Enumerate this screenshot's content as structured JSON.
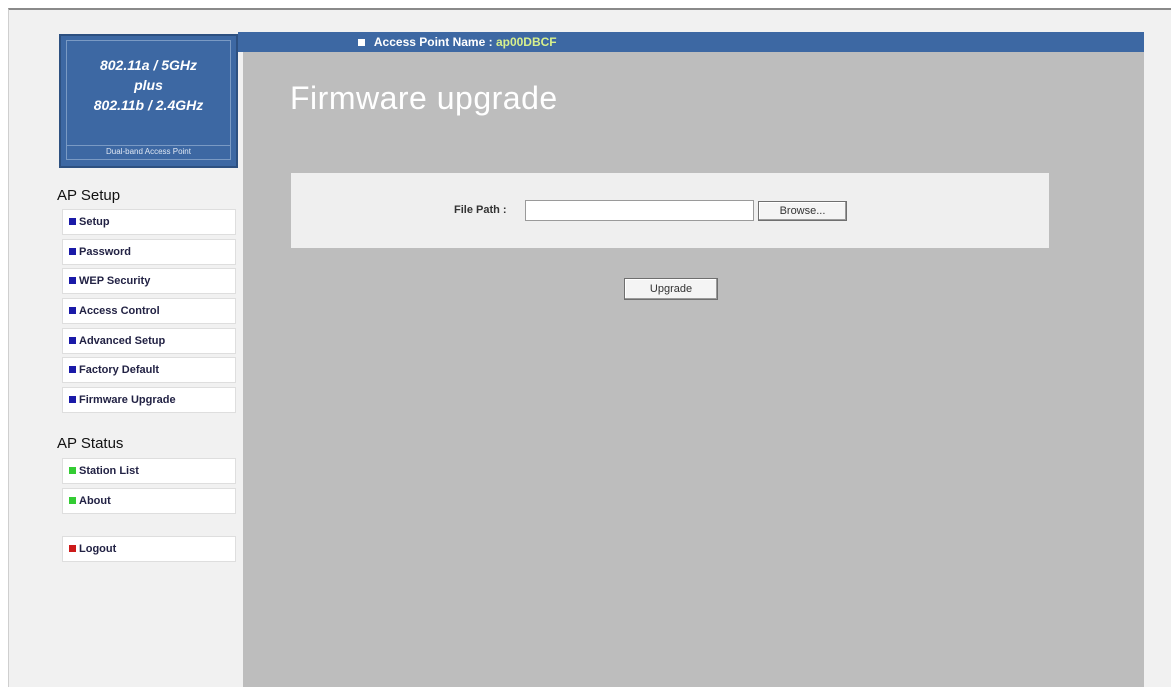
{
  "header": {
    "ap_label": "Access Point Name :",
    "ap_name": "ap00DBCF"
  },
  "logo": {
    "line1": "802.11a / 5GHz",
    "line2": "plus",
    "line3": "802.11b / 2.4GHz",
    "subtitle": "Dual-band Access Point"
  },
  "sidebar": {
    "setup_title": "AP Setup",
    "setup_items": [
      {
        "label": "Setup"
      },
      {
        "label": "Password"
      },
      {
        "label": "WEP Security"
      },
      {
        "label": "Access Control"
      },
      {
        "label": "Advanced Setup"
      },
      {
        "label": "Factory Default"
      },
      {
        "label": "Firmware Upgrade"
      }
    ],
    "status_title": "AP Status",
    "status_items": [
      {
        "label": "Station List"
      },
      {
        "label": "About"
      }
    ],
    "logout_label": "Logout"
  },
  "main": {
    "title": "Firmware upgrade",
    "file_path_label": "File Path :",
    "file_path_value": "",
    "browse_label": "Browse...",
    "upgrade_label": "Upgrade"
  },
  "colors": {
    "header_bar": "#3d68a3",
    "content_bg": "#bdbdbd",
    "sidebar_bg": "#f1f1f1",
    "bullet_setup": "#1a1aa8",
    "bullet_status": "#33cc33",
    "bullet_logout": "#cc1a1a",
    "ap_name": "#d8f08c"
  },
  "icons": {
    "setup_bullet": "blue-square-icon",
    "status_bullet": "green-square-icon",
    "logout_bullet": "red-square-icon"
  }
}
